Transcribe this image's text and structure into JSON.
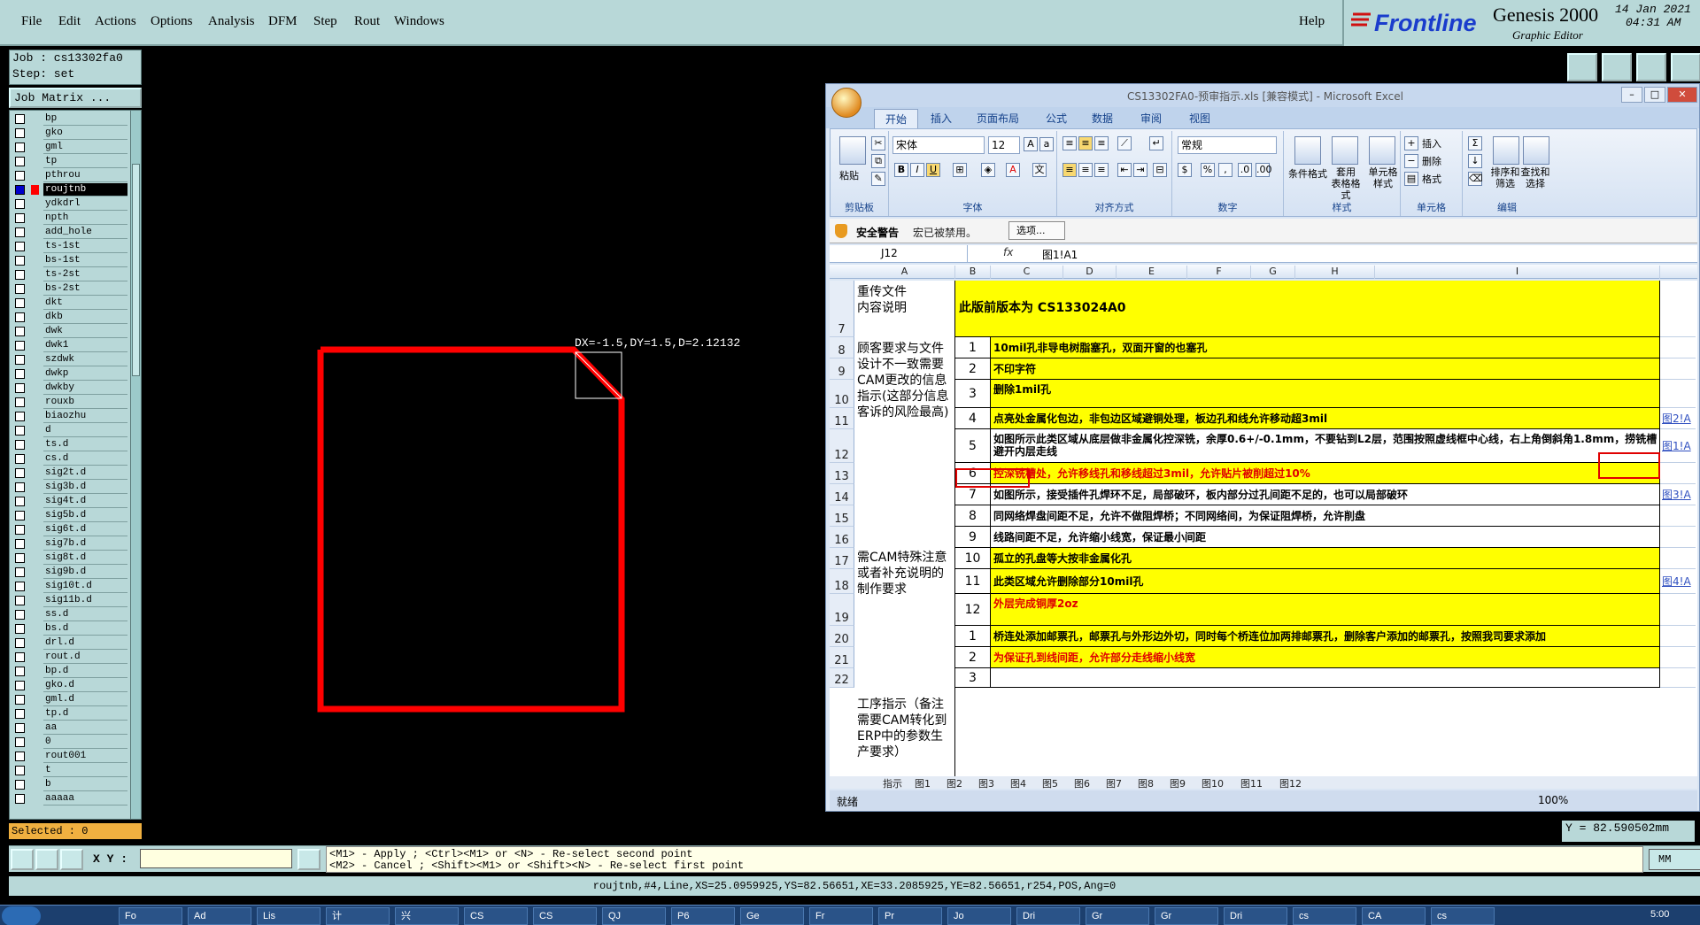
{
  "menu": [
    "File",
    "Edit",
    "Actions",
    "Options",
    "Analysis",
    "DFM",
    "Step",
    "Rout",
    "Windows"
  ],
  "help": "Help",
  "brand": {
    "logo": "Frontline",
    "product": "Genesis 2000",
    "subtitle": "Graphic Editor",
    "date": "14 Jan 2021",
    "time": "04:31 AM"
  },
  "job": {
    "job_line": "Job : cs13302fa0",
    "step_line": "Step: set",
    "matrix_button": "Job Matrix ..."
  },
  "layers": [
    "bp",
    "gko",
    "gml",
    "tp",
    "pthrou",
    "roujtnb",
    "ydkdrl",
    "npth",
    "add_hole",
    "ts-1st",
    "bs-1st",
    "ts-2st",
    "bs-2st",
    "dkt",
    "dkb",
    "dwk",
    "dwk1",
    "szdwk",
    "dwkp",
    "dwkby",
    "rouxb",
    "biaozhu",
    "d",
    "ts.d",
    "cs.d",
    "sig2t.d",
    "sig3b.d",
    "sig4t.d",
    "sig5b.d",
    "sig6t.d",
    "sig7b.d",
    "sig8t.d",
    "sig9b.d",
    "sig10t.d",
    "sig11b.d",
    "ss.d",
    "bs.d",
    "drl.d",
    "rout.d",
    "bp.d",
    "gko.d",
    "gml.d",
    "tp.d",
    "aa",
    "0",
    "rout001",
    "t",
    "b",
    "aaaaa"
  ],
  "active_layer": "roujtnb",
  "selected": "Selected : 0",
  "measure": "DX=-1.5,DY=1.5,D=2.12132",
  "coord_y": "Y = 82.590502mm",
  "xy_label": "X Y :",
  "hint_line1": "<M1> - Apply  ; <Ctrl><M1> or <N> - Re-select second point",
  "hint_line2": "<M2> - Cancel ; <Shift><M1> or <Shift><N> - Re-select first point",
  "units": "MM",
  "info": "roujtnb,#4,Line,XS=25.0959925,YS=82.56651,XE=33.2085925,YE=82.56651,r254,POS,Ang=0",
  "excel": {
    "title": "CS13302FA0-预审指示.xls  [兼容模式] - Microsoft Excel",
    "tabs": [
      "开始",
      "插入",
      "页面布局",
      "公式",
      "数据",
      "审阅",
      "视图"
    ],
    "font_name": "宋体",
    "font_size": "12",
    "number_format": "常规",
    "groups": [
      "剪贴板",
      "字体",
      "对齐方式",
      "数字",
      "样式",
      "单元格",
      "编辑"
    ],
    "btn_paste": "粘贴",
    "btn_condfmt": "条件格式",
    "btn_tablefmt": "套用\n表格格式",
    "btn_cellstyle": "单元格\n样式",
    "btn_insert": "插入",
    "btn_delete": "删除",
    "btn_format": "格式",
    "btn_sort": "排序和\n筛选",
    "btn_find": "查找和\n选择",
    "security_label": "安全警告",
    "security_msg": "宏已被禁用。",
    "options_btn": "选项...",
    "namebox": "J12",
    "fx": "fx",
    "formula": "图1!A1",
    "cols": [
      "A",
      "B",
      "C",
      "D",
      "E",
      "F",
      "G",
      "H",
      "I"
    ],
    "rows": [
      {
        "r": "7",
        "n": "",
        "t": "此版前版本为 CS133024A0",
        "y": true
      },
      {
        "r": "8",
        "n": "1",
        "t": "10mil孔非导电树脂塞孔，双面开窗的也塞孔",
        "y": true
      },
      {
        "r": "9",
        "n": "2",
        "t": "不印字符",
        "y": true
      },
      {
        "r": "10",
        "n": "3",
        "t": "删除1mil孔",
        "y": true
      },
      {
        "r": "11",
        "n": "4",
        "t": "点亮处金属化包边，非包边区域避铜处理，板边孔和线允许移动超3mil",
        "y": true,
        "l": "图2!A"
      },
      {
        "r": "12",
        "n": "5",
        "t": "如图所示此类区域从底层做非金属化控深铣，余厚0.6+/-0.1mm，不要钻到L2层，范围按照虚线框中心线，右上角倒斜角1.8mm，捞铣槽避开内层走线",
        "y": false,
        "l": "图1!A"
      },
      {
        "r": "13",
        "n": "6",
        "t": "控深铣槽处，允许移线孔和移线超过3mil，允许贴片被削超过10%",
        "y": true,
        "red": true
      },
      {
        "r": "14",
        "n": "7",
        "t": "如图所示，接受插件孔焊环不足，局部破环，板内部分过孔间距不足的，也可以局部破环",
        "y": false,
        "l": "图3!A"
      },
      {
        "r": "15",
        "n": "8",
        "t": "同网络焊盘间距不足，允许不做阻焊桥；不同网络间，为保证阻焊桥，允许削盘",
        "y": false
      },
      {
        "r": "16",
        "n": "9",
        "t": "线路间距不足，允许缩小线宽，保证最小间距",
        "y": false
      },
      {
        "r": "17",
        "n": "10",
        "t": "孤立的孔盘等大按非金属化孔",
        "y": true
      },
      {
        "r": "18",
        "n": "11",
        "t": "此类区域允许删除部分10mil孔",
        "y": true,
        "l": "图4!A"
      },
      {
        "r": "19",
        "n": "12",
        "t": "外层完成铜厚2oz",
        "y": true,
        "red": true
      },
      {
        "r": "20",
        "n": "1",
        "t": "桥连处添加邮票孔，邮票孔与外形边外切，同时每个桥连位加两排邮票孔，删除客户添加的邮票孔，按照我司要求添加",
        "y": true
      },
      {
        "r": "21",
        "n": "2",
        "t": "为保证孔到线间距，允许部分走线缩小线宽",
        "y": true,
        "red": true
      },
      {
        "r": "22",
        "n": "3",
        "t": "",
        "y": false
      }
    ],
    "colA": [
      "重传文件\n内容说明",
      "顾客要求与文件设计不一致需要CAM更改的信息指示(这部分信息客诉的风险最高)",
      "需CAM特殊注意或者补充说明的制作要求",
      "工序指示（备注需要CAM转化到ERP中的参数生产要求）"
    ],
    "sheet_tabs": [
      "指示",
      "图1",
      "图2",
      "图3",
      "图4",
      "图5",
      "图6",
      "图7",
      "图8",
      "图9",
      "图10",
      "图11",
      "图12"
    ],
    "status": "就绪",
    "zoom": "100%"
  },
  "taskbar": [
    "Fo",
    "Ad",
    "Lis",
    "计",
    "兴",
    "CS",
    "CS",
    "QJ",
    "P6",
    "Ge",
    "Fr",
    "Pr",
    "Jo",
    "Dri",
    "Gr",
    "Gr",
    "Dri",
    "cs",
    "CA",
    "cs"
  ],
  "clock": "5:00"
}
